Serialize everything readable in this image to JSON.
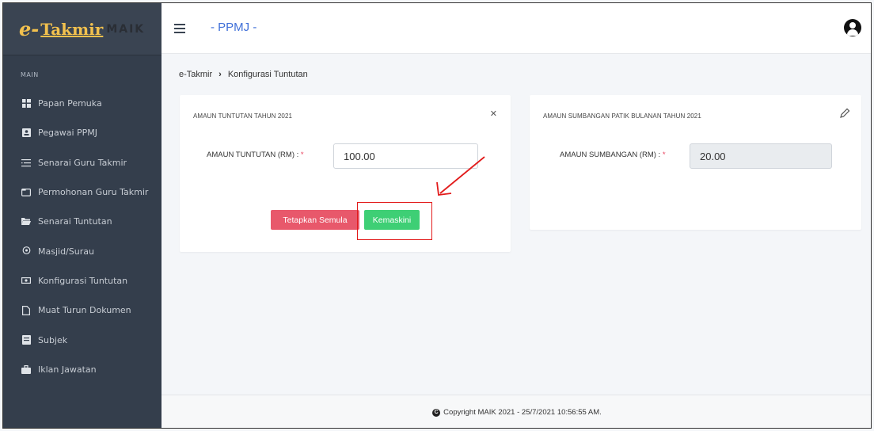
{
  "brand": {
    "prefix": "e-",
    "name": "Takmir",
    "suffix": "MAIK"
  },
  "topbar": {
    "title": "- PPMJ -"
  },
  "sidebar": {
    "section": "MAIN",
    "items": [
      {
        "label": "Papan Pemuka",
        "icon": "dashboard-icon"
      },
      {
        "label": "Pegawai PPMJ",
        "icon": "id-card-icon"
      },
      {
        "label": "Senarai Guru Takmir",
        "icon": "list-icon"
      },
      {
        "label": "Permohonan Guru Takmir",
        "icon": "folder-outline-icon"
      },
      {
        "label": "Senarai Tuntutan",
        "icon": "folder-open-icon"
      },
      {
        "label": "Masjid/Surau",
        "icon": "location-icon"
      },
      {
        "label": "Konfigurasi Tuntutan",
        "icon": "money-icon"
      },
      {
        "label": "Muat Turun Dokumen",
        "icon": "file-icon"
      },
      {
        "label": "Subjek",
        "icon": "book-icon"
      },
      {
        "label": "Iklan Jawatan",
        "icon": "briefcase-icon"
      }
    ]
  },
  "breadcrumb": {
    "root": "e-Takmir",
    "current": "Konfigurasi Tuntutan"
  },
  "card_claim": {
    "title": "AMAUN TUNTUTAN TAHUN 2021",
    "field_label": "AMAUN TUNTUTAN (RM) :",
    "field_value": "100.00",
    "reset_label": "Tetapkan Semula",
    "update_label": "Kemaskini"
  },
  "card_contribution": {
    "title": "AMAUN SUMBANGAN PATIK BULANAN TAHUN 2021",
    "field_label": "AMAUN SUMBANGAN (RM) :",
    "field_value": "20.00"
  },
  "footer": {
    "text": "Copyright MAIK 2021 - 25/7/2021 10:56:55 AM."
  },
  "colors": {
    "sidebar": "#343e4c",
    "accent_title": "#3f6fd8",
    "reset": "#e8586b",
    "update": "#3ecf75",
    "annotation": "#e21b1b"
  }
}
